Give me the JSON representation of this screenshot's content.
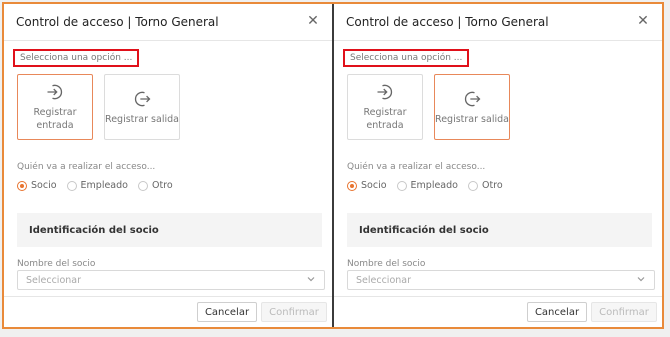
{
  "dialogs": [
    {
      "title": "Control de acceso | Torno General",
      "select_prompt": "Selecciona una opción ...",
      "options": [
        {
          "label": "Registrar entrada",
          "icon": "login-icon",
          "selected": true
        },
        {
          "label": "Registrar salida",
          "icon": "logout-icon",
          "selected": false
        }
      ],
      "question": "Quién va a realizar el acceso...",
      "radios": [
        {
          "label": "Socio",
          "checked": true
        },
        {
          "label": "Empleado",
          "checked": false
        },
        {
          "label": "Otro",
          "checked": false
        }
      ],
      "section_title": "Identificación del socio",
      "field_label": "Nombre del socio",
      "field_placeholder": "Seleccionar",
      "cancel_label": "Cancelar",
      "confirm_label": "Confirmar"
    },
    {
      "title": "Control de acceso | Torno General",
      "select_prompt": "Selecciona una opción ...",
      "options": [
        {
          "label": "Registrar entrada",
          "icon": "login-icon",
          "selected": false
        },
        {
          "label": "Registrar salida",
          "icon": "logout-icon",
          "selected": true
        }
      ],
      "question": "Quién va a realizar el acceso...",
      "radios": [
        {
          "label": "Socio",
          "checked": true
        },
        {
          "label": "Empleado",
          "checked": false
        },
        {
          "label": "Otro",
          "checked": false
        }
      ],
      "section_title": "Identificación del socio",
      "field_label": "Nombre del socio",
      "field_placeholder": "Seleccionar",
      "cancel_label": "Cancelar",
      "confirm_label": "Confirmar"
    }
  ],
  "colors": {
    "accent": "#e8732e",
    "highlight_box": "#e0101a",
    "outer_border": "#e98a3a"
  }
}
